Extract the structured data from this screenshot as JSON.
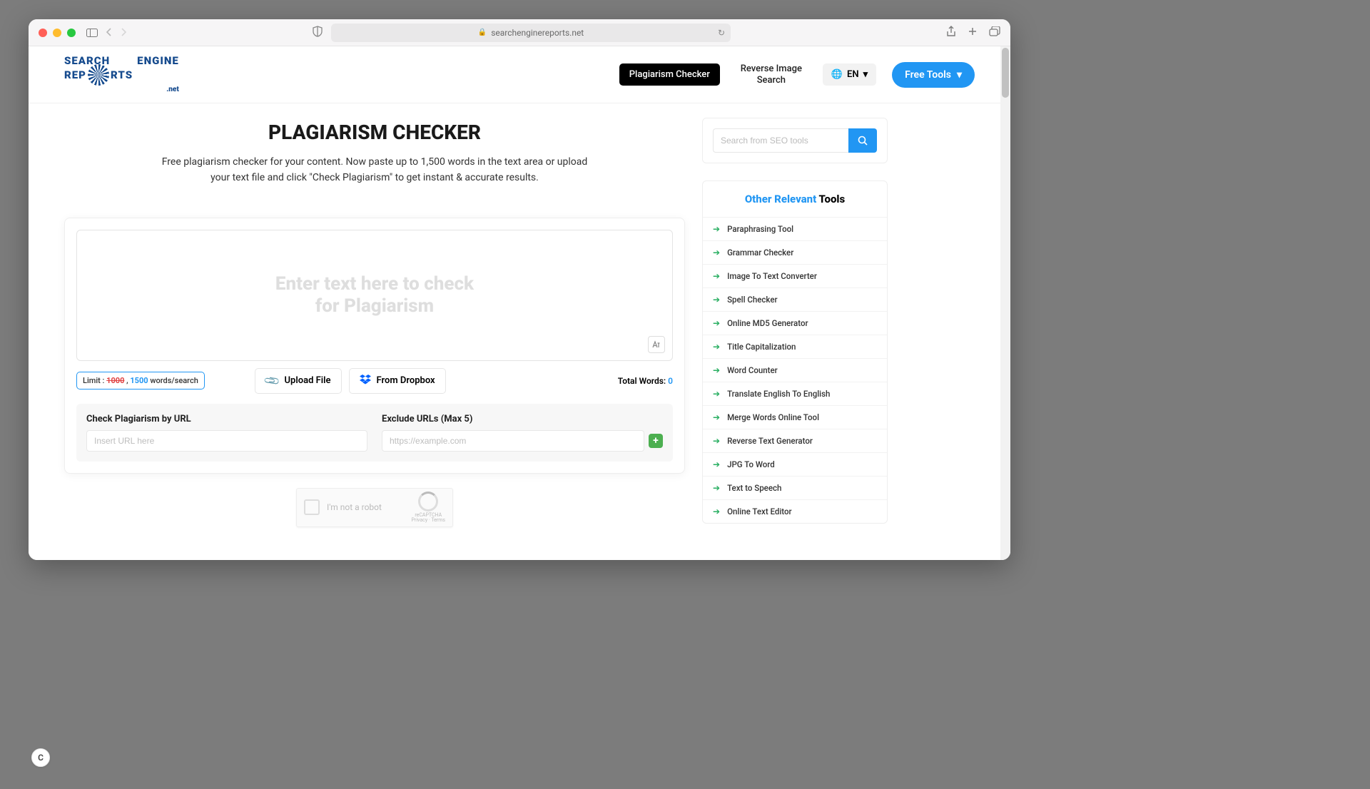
{
  "browser": {
    "url": "searchenginereports.net"
  },
  "logo": {
    "search": "SEARCH",
    "engine": "ENGINE",
    "reports": "REP",
    "reports2": "RTS",
    "net": ".net"
  },
  "nav": {
    "plagiarism": "Plagiarism Checker",
    "reverse_image": "Reverse Image Search",
    "lang": "EN",
    "free_tools": "Free Tools"
  },
  "page": {
    "title": "PLAGIARISM CHECKER",
    "subtitle": "Free plagiarism checker for your content. Now paste up to 1,500 words in the text area or upload your text file and click \"Check Plagiarism\" to get instant & accurate results."
  },
  "editor": {
    "placeholder_l1": "Enter text here to check",
    "placeholder_l2": "for Plagiarism",
    "limit_prefix": "Limit : ",
    "limit_old": "1000",
    "limit_sep": " , ",
    "limit_new": "1500",
    "limit_suffix": " words/search",
    "upload": "Upload File",
    "dropbox": "From Dropbox",
    "total_words_label": "Total Words: ",
    "total_words_count": "0",
    "url_label": "Check Plagiarism by URL",
    "url_placeholder": "Insert URL here",
    "exclude_label": "Exclude URLs (Max 5)",
    "exclude_placeholder": "https://example.com"
  },
  "search": {
    "placeholder": "Search from SEO tools"
  },
  "tools_header": {
    "blue": "Other Relevant",
    "black": " Tools"
  },
  "tools": [
    "Paraphrasing Tool",
    "Grammar Checker",
    "Image To Text Converter",
    "Spell Checker",
    "Online MD5 Generator",
    "Title Capitalization",
    "Word Counter",
    "Translate English To English",
    "Merge Words Online Tool",
    "Reverse Text Generator",
    "JPG To Word",
    "Text to Speech",
    "Online Text Editor"
  ],
  "recaptcha": {
    "text": "I'm not a robot",
    "brand": "reCAPTCHA",
    "legal": "Privacy · Terms"
  },
  "overlay_badge": "C"
}
